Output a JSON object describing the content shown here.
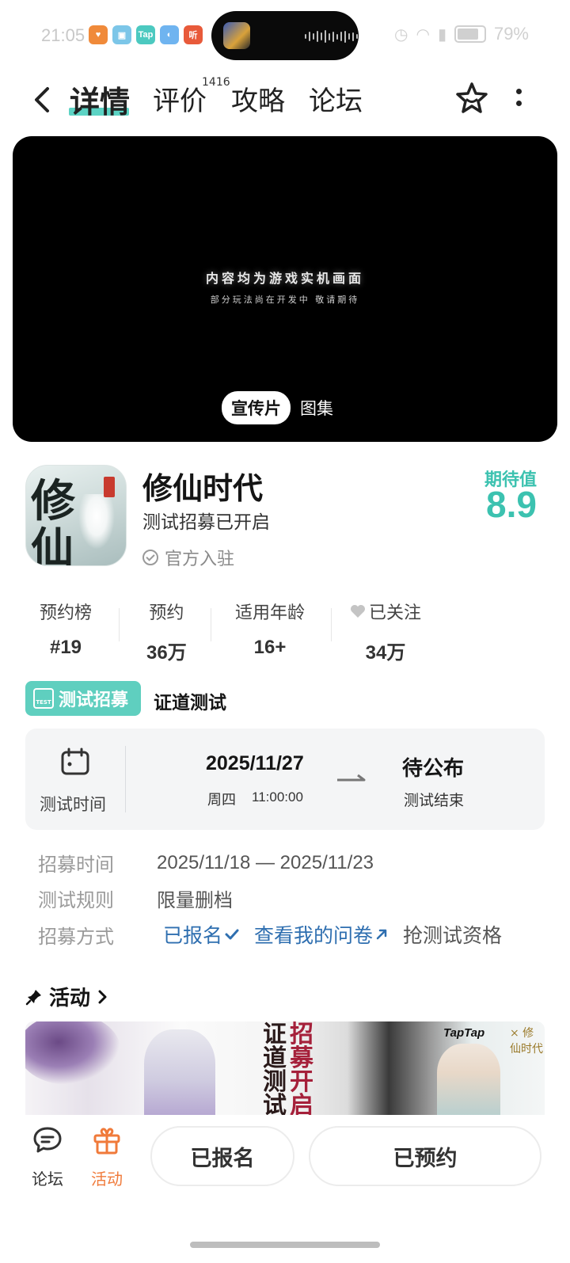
{
  "status_bar": {
    "time": "21:05",
    "apps": [
      {
        "label": "♥",
        "color": "#f08a3a"
      },
      {
        "label": "▣",
        "color": "#7cc6e8"
      },
      {
        "label": "Tap",
        "color": "#4cc9c0"
      },
      {
        "label": "◐",
        "color": "#6fb4f0"
      },
      {
        "label": "听",
        "color": "#e85a3a"
      }
    ],
    "battery": "79%"
  },
  "nav": {
    "tabs": [
      "详情",
      "评价",
      "攻略",
      "论坛"
    ],
    "active_tab": "详情",
    "review_count": "1416"
  },
  "video": {
    "caption_main": "内容均为游戏实机画面",
    "caption_sub": "部分玩法尚在开发中 敬请期待",
    "tabs": [
      "宣传片",
      "图集"
    ]
  },
  "app": {
    "name": "修仙时代",
    "subtitle": "测试招募已开启",
    "official": "官方入驻",
    "icon_text": [
      "修",
      "仙"
    ],
    "expect_label": "期待值",
    "expect_score": "8.9",
    "accent_color": "#3cc2b0"
  },
  "stats": [
    {
      "label": "预约榜",
      "value": "#19"
    },
    {
      "label": "预约",
      "value": "36万"
    },
    {
      "label": "适用年龄",
      "value": "16+"
    },
    {
      "label": "已关注",
      "value": "34万"
    }
  ],
  "recruit": {
    "badge": "测试招募",
    "badge_icon_text": "TEST",
    "name": "证道测试",
    "card": {
      "label": "测试时间",
      "start_date": "2025/11/27",
      "start_weekday": "周四",
      "start_time": "11:00:00",
      "end_value": "待公布",
      "end_label": "测试结束"
    },
    "rows": [
      {
        "key": "招募时间",
        "value": "2025/11/18 — 2025/11/23"
      },
      {
        "key": "测试规则",
        "value": "限量删档"
      }
    ],
    "method_key": "招募方式",
    "method_signed": "已报名",
    "method_survey": "查看我的问卷",
    "method_grab": "抢测试资格"
  },
  "activity": {
    "title": "活动",
    "banner_text": [
      "证",
      "招",
      "道",
      "募",
      "测",
      "开",
      "试",
      "启"
    ],
    "banner_logo": "TapTap",
    "banner_logo2": "× 修仙时代"
  },
  "bottom_bar": {
    "forum": "论坛",
    "activity": "活动",
    "signed_button": "已报名",
    "reserved_button": "已预约",
    "activity_color": "#f07a3a"
  }
}
